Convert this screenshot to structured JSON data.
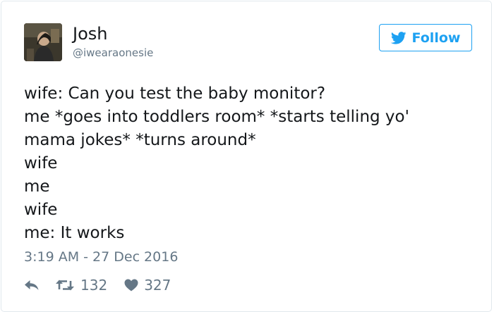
{
  "tweet": {
    "author": {
      "display_name": "Josh",
      "handle": "@iwearaonesie"
    },
    "follow_label": "Follow",
    "lines": [
      "wife: Can you test the baby monitor?",
      "me *goes into toddlers room* *starts telling yo'",
      "mama jokes* *turns around*",
      "wife",
      "me",
      "wife",
      "me: It works"
    ],
    "timestamp": "3:19 AM - 27 Dec 2016",
    "retweets": "132",
    "likes": "327"
  },
  "icons": {
    "follow": "twitter-bird-icon",
    "reply": "reply-arrow-icon",
    "retweet": "retweet-icon",
    "like": "heart-icon"
  },
  "colors": {
    "accent": "#1da1f2",
    "text": "#14171a",
    "secondary_text": "#657786",
    "border": "#e1e8ed"
  }
}
